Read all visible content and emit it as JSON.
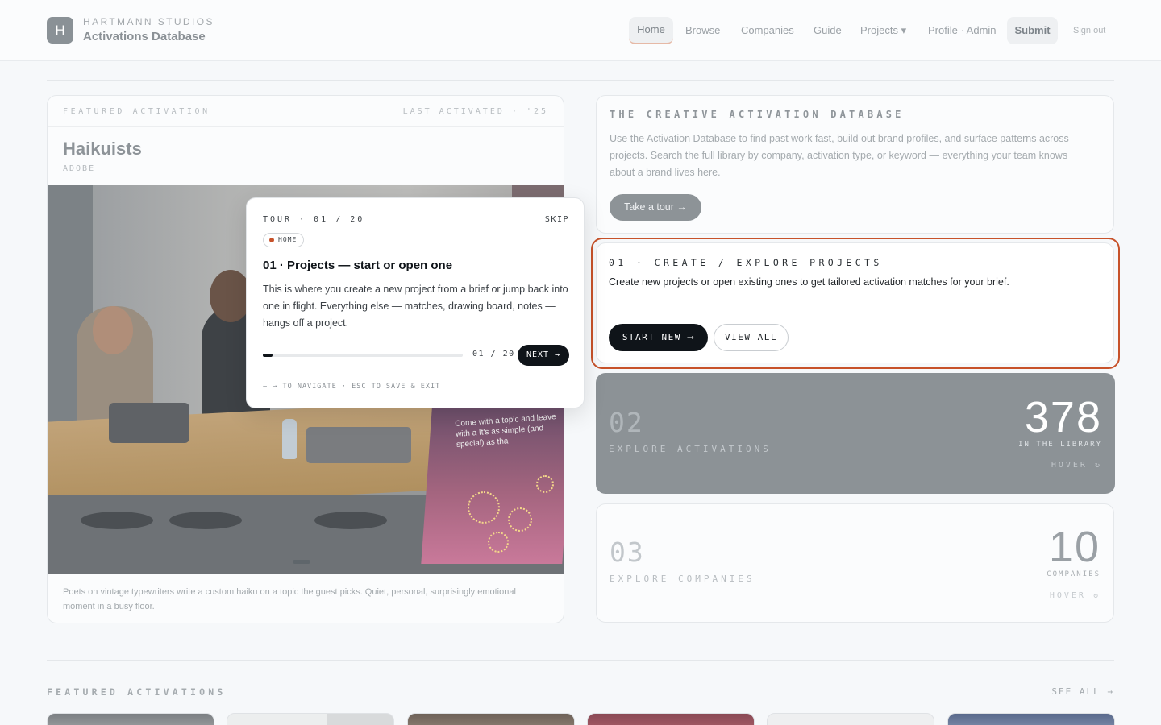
{
  "header": {
    "logo_letter": "H",
    "studio": "HARTMANN STUDIOS",
    "app_title": "Activations Database"
  },
  "nav": {
    "home": "Home",
    "browse": "Browse",
    "companies": "Companies",
    "guide": "Guide",
    "projects": "Projects ▾",
    "profile": "Profile · Admin",
    "submit": "Submit",
    "signout": "Sign out"
  },
  "featured": {
    "label": "FEATURED ACTIVATION",
    "last_activated": "LAST ACTIVATED · '25",
    "title": "Haikuists",
    "company": "ADOBE",
    "poster_text": "Come with a topic and leave with a It's as simple (and special) as tha",
    "description": "Poets on vintage typewriters write a custom haiku on a topic the guest picks. Quiet, personal, surprisingly emotional moment in a busy floor."
  },
  "database": {
    "title": "THE CREATIVE ACTIVATION DATABASE",
    "text": "Use the Activation Database to find past work fast, build out brand profiles, and surface patterns across projects. Search the full library by company, activation type, or keyword — everything your team knows about a brand lives here.",
    "tour_button": "Take a tour  →"
  },
  "projects": {
    "title": "01 · CREATE / EXPLORE PROJECTS",
    "text": "Create new projects or open existing ones to get tailored activation matches for your brief.",
    "start_button": "START NEW ⟶",
    "view_button": "VIEW ALL"
  },
  "activations": {
    "num": "02",
    "label": "EXPLORE ACTIVATIONS",
    "count": "378",
    "count_label": "IN THE LIBRARY",
    "hover": "HOVER ↻"
  },
  "companies": {
    "num": "03",
    "label": "EXPLORE COMPANIES",
    "count": "10",
    "count_label": "COMPANIES",
    "hover": "HOVER ↻"
  },
  "tour": {
    "step": "TOUR · 01 / 20",
    "skip": "SKIP",
    "tag": "HOME",
    "title": "01 · Projects — start or open one",
    "body": "This is where you create a new project from a brief or jump back into one in flight. Everything else — matches, drawing board, notes — hangs off a project.",
    "counter": "01 / 20",
    "progress": 0.05,
    "next": "NEXT →",
    "hint": "← → TO NAVIGATE · ESC TO SAVE & EXIT"
  },
  "featured_strip": {
    "heading": "FEATURED ACTIVATIONS",
    "see_all": "SEE ALL →"
  },
  "colors": {
    "accent": "#c7522a",
    "dark": "#0f1419",
    "muted_card": "#8c9296"
  }
}
